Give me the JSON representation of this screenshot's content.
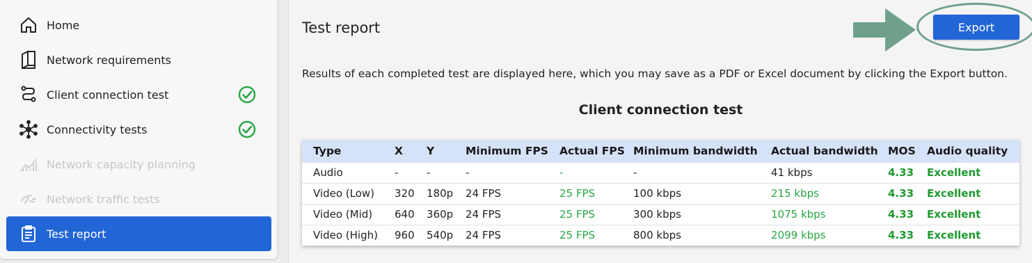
{
  "sidebar": {
    "items": [
      {
        "label": "Home",
        "icon": "home-icon",
        "state": "normal",
        "check": false
      },
      {
        "label": "Network requirements",
        "icon": "book-icon",
        "state": "normal",
        "check": false
      },
      {
        "label": "Client connection test",
        "icon": "route-icon",
        "state": "normal",
        "check": true
      },
      {
        "label": "Connectivity tests",
        "icon": "network-icon",
        "state": "normal",
        "check": true
      },
      {
        "label": "Network capacity planning",
        "icon": "capacity-chart-icon",
        "state": "disabled",
        "check": false
      },
      {
        "label": "Network traffic tests",
        "icon": "traffic-icon",
        "state": "disabled",
        "check": false
      },
      {
        "label": "Test report",
        "icon": "clipboard-icon",
        "state": "active",
        "check": false
      }
    ]
  },
  "main": {
    "title": "Test report",
    "export_label": "Export",
    "description": "Results of each completed test are displayed here, which you may save as a PDF or Excel document by clicking the Export button.",
    "section_title": "Client connection test"
  },
  "table": {
    "headers": [
      "Type",
      "X",
      "Y",
      "Minimum FPS",
      "Actual FPS",
      "Minimum bandwidth",
      "Actual bandwidth",
      "MOS",
      "Audio quality"
    ],
    "rows": [
      [
        "Audio",
        "-",
        "-",
        "-",
        "-",
        "-",
        "41 kbps",
        "4.33",
        "Excellent"
      ],
      [
        "Video (Low)",
        "320",
        "180p",
        "24 FPS",
        "25 FPS",
        "100 kbps",
        "215 kbps",
        "4.33",
        "Excellent"
      ],
      [
        "Video (Mid)",
        "640",
        "360p",
        "24 FPS",
        "25 FPS",
        "300 kbps",
        "1075 kbps",
        "4.33",
        "Excellent"
      ],
      [
        "Video (High)",
        "960",
        "540p",
        "24 FPS",
        "25 FPS",
        "800 kbps",
        "2099 kbps",
        "4.33",
        "Excellent"
      ]
    ]
  },
  "colors": {
    "accent": "#2266d6",
    "success": "#28a745",
    "annotation": "#6fa08b",
    "table_header_bg": "#d6e2f8"
  }
}
